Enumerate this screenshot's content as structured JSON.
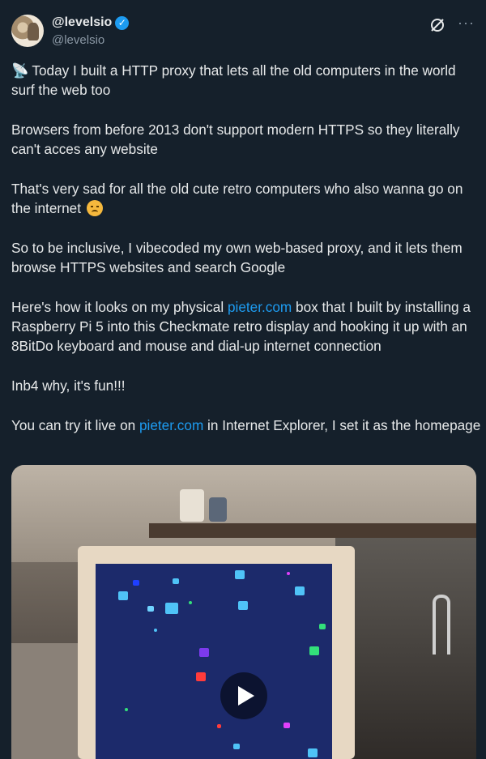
{
  "author": {
    "display_name": "@levelsio",
    "handle": "@levelsio",
    "verified": true
  },
  "icons": {
    "header_right": [
      "grok-icon",
      "more-icon"
    ],
    "more_glyph": "···"
  },
  "tweet": {
    "p1": "Today I built a HTTP proxy that lets all the old computers in the world surf the web too",
    "p2": "Browsers from before 2013 don't support modern HTTPS so they literally can't acces any website",
    "p3": "That's very sad for all the old cute retro computers who also wanna go on the internet",
    "p4": "So to be inclusive, I vibecoded my own web-based proxy, and it lets them browse HTTPS websites and search Google",
    "p5_before": "Here's how it looks on my physical ",
    "p5_link": "pieter.com",
    "p5_after": " box that I built by installing a Raspberry Pi 5 into this Checkmate retro display and hooking it up with an 8BitDo keyboard and mouse and dial-up internet connection",
    "p6": "Inb4 why, it's fun!!!",
    "p7_before": "You can try it live on ",
    "p7_link": "pieter.com",
    "p7_after": " in Internet Explorer, I set it as the homepage"
  },
  "colors": {
    "background": "#15202b",
    "text": "#e7e9ea",
    "secondary": "#8b98a5",
    "link": "#1d9bf0"
  }
}
